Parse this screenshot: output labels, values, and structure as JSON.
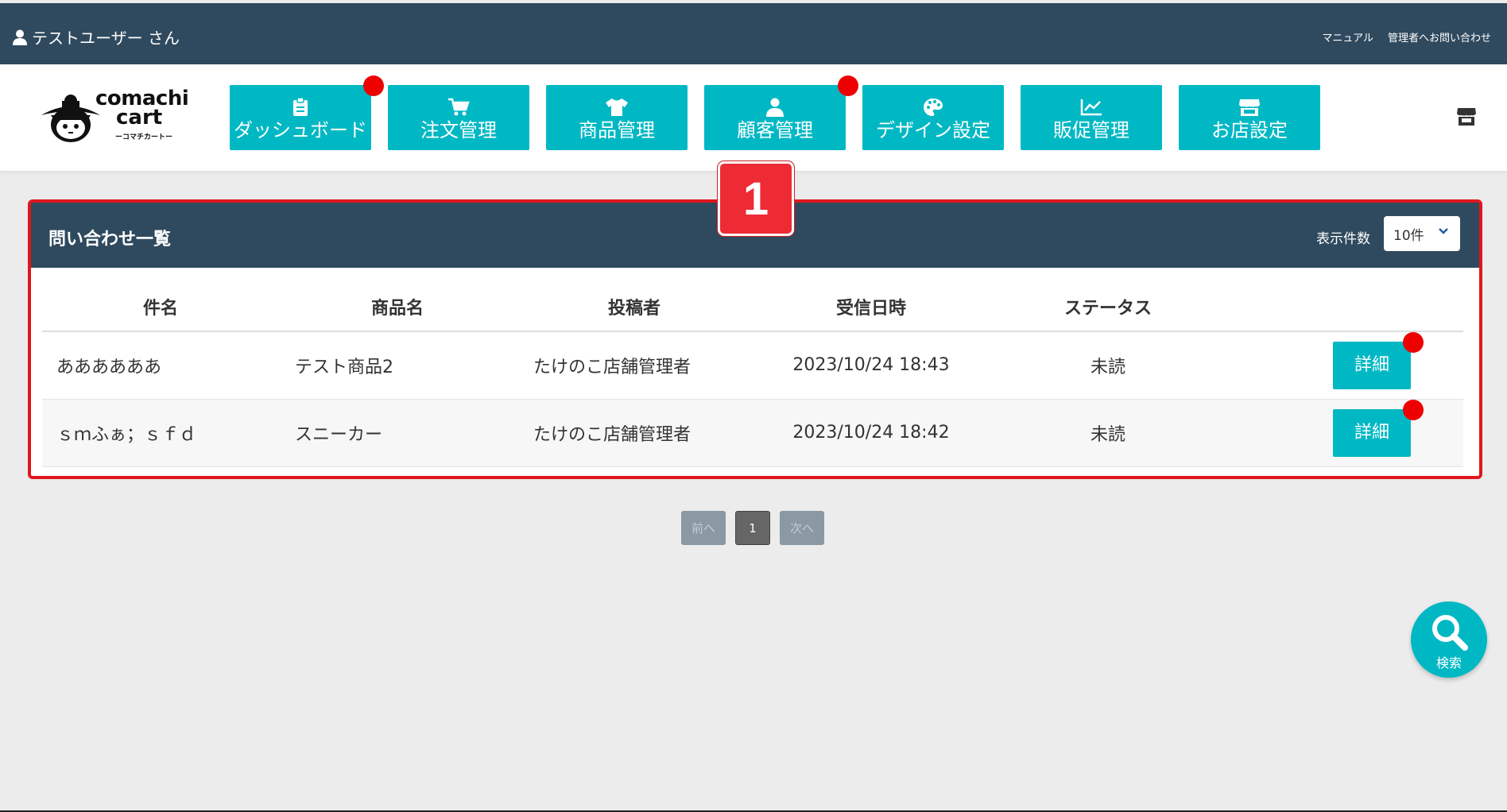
{
  "topbar": {
    "user_name": "テストユーザー さん",
    "links": [
      "マニュアル",
      "管理者へお問い合わせ"
    ]
  },
  "logo": {
    "line1": "comachi",
    "line2": "cart",
    "line3": "ーコマチカートー"
  },
  "nav": [
    {
      "label": "ダッシュボード",
      "icon": "clipboard-icon",
      "badge": true
    },
    {
      "label": "注文管理",
      "icon": "cart-icon",
      "badge": false
    },
    {
      "label": "商品管理",
      "icon": "shirt-icon",
      "badge": false
    },
    {
      "label": "顧客管理",
      "icon": "user-icon",
      "badge": true
    },
    {
      "label": "デザイン設定",
      "icon": "palette-icon",
      "badge": false
    },
    {
      "label": "販促管理",
      "icon": "chart-line-icon",
      "badge": false
    },
    {
      "label": "お店設定",
      "icon": "store-icon",
      "badge": false
    }
  ],
  "panel": {
    "title": "問い合わせ一覧",
    "per_page_label": "表示件数",
    "per_page_value": "10件",
    "annotation_number": "1"
  },
  "table": {
    "headers": [
      "件名",
      "商品名",
      "投稿者",
      "受信日時",
      "ステータス",
      ""
    ],
    "rows": [
      {
        "subject": "ああああああ",
        "product": "テスト商品2",
        "poster": "たけのこ店舗管理者",
        "received": "2023/10/24 18:43",
        "status": "未読",
        "action": "詳細"
      },
      {
        "subject": "ｓｍふぁ；ｓｆｄ",
        "product": "スニーカー",
        "poster": "たけのこ店舗管理者",
        "received": "2023/10/24 18:42",
        "status": "未読",
        "action": "詳細"
      }
    ]
  },
  "pagination": {
    "prev": "前へ",
    "current": "1",
    "next": "次へ"
  },
  "search_fab": {
    "label": "検索"
  },
  "colors": {
    "navy": "#2f4a5e",
    "teal": "#00b8c4",
    "badge_red": "#ee0000",
    "highlight_red": "#e0161d"
  }
}
